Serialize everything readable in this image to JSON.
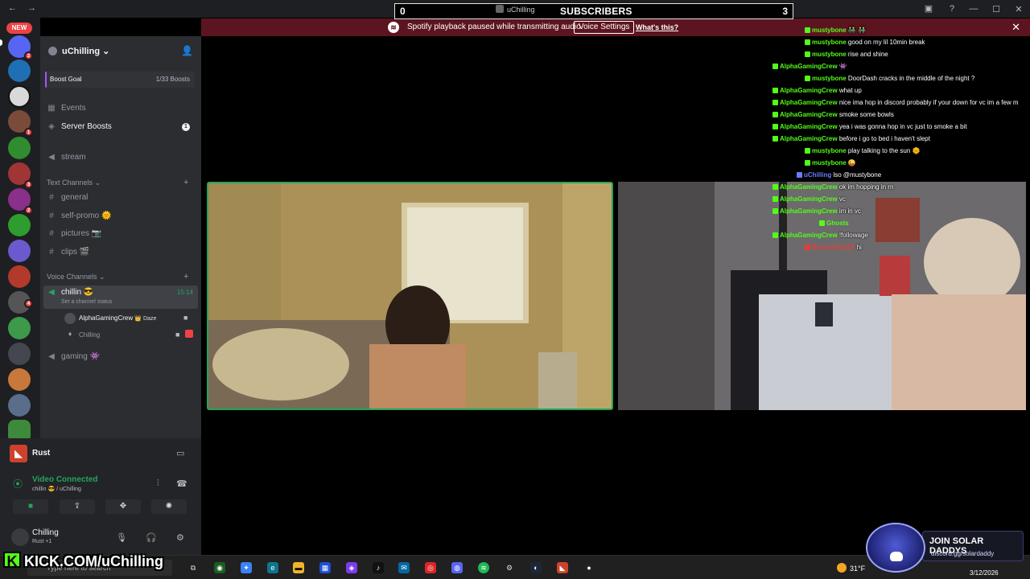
{
  "badge_new": "NEW",
  "subscribers": {
    "left": "0",
    "user": "uChilling",
    "label": "SUBSCRIBERS",
    "right": "3"
  },
  "notice": {
    "message": "Spotify playback paused while transmitting audio.",
    "button": "Voice Settings",
    "link": "What's this?"
  },
  "server": {
    "name": "uChilling",
    "boost_goal_label": "Boost Goal",
    "boost_goal_value": "1/33 Boosts",
    "events": "Events",
    "server_boosts": "Server Boosts",
    "server_boosts_count": "1",
    "stream": "stream",
    "text_category": "Text Channels",
    "text_channels": [
      "general",
      "self-promo 🌞",
      "pictures 📷",
      "clips 🎬"
    ],
    "voice_category": "Voice Channels",
    "voice_channel": {
      "name": "chillin 😎",
      "status": "Set a channel status",
      "time": "15:14"
    },
    "voice_users": [
      {
        "name": "AlphaGamingCrew",
        "tag": "👑 Daze"
      },
      {
        "name": "Chilling",
        "tag": ""
      }
    ],
    "gaming": "gaming 👾"
  },
  "rail_badges": [
    "2",
    "1",
    "3",
    "2",
    "4"
  ],
  "voice_panel": {
    "game": "Rust",
    "status": "Video Connected",
    "location": "chillin 😎 / uChilling"
  },
  "user_panel": {
    "name": "Chilling",
    "status": "Rust +1"
  },
  "chat": [
    {
      "user": "mustybone",
      "msg": "👬 👬",
      "color": "#53fc18",
      "indent": 1
    },
    {
      "user": "mustybone",
      "msg": "good on my lil 10min break",
      "color": "#53fc18",
      "indent": 1
    },
    {
      "user": "mustybone",
      "msg": "rise and shine",
      "color": "#53fc18",
      "indent": 1
    },
    {
      "user": "AlphaGamingCrew",
      "msg": "👾",
      "color": "#53fc18",
      "indent": 0
    },
    {
      "user": "mustybone",
      "msg": "DoorDash cracks in the middle of the night ?",
      "color": "#53fc18",
      "indent": 1
    },
    {
      "user": "AlphaGamingCrew",
      "msg": "what up",
      "color": "#53fc18",
      "indent": 0
    },
    {
      "user": "AlphaGamingCrew",
      "msg": "nice ima hop in discord probably if your down for vc im a few m",
      "color": "#53fc18",
      "indent": 0
    },
    {
      "user": "AlphaGamingCrew",
      "msg": "smoke some bowls",
      "color": "#53fc18",
      "indent": 0
    },
    {
      "user": "AlphaGamingCrew",
      "msg": "yea i was gonna hop in vc just to smoke a bit",
      "color": "#53fc18",
      "indent": 0
    },
    {
      "user": "AlphaGamingCrew",
      "msg": "before i go to bed i haven't slept",
      "color": "#53fc18",
      "indent": 0
    },
    {
      "user": "mustybone",
      "msg": "play talking to the sun 🌞",
      "color": "#53fc18",
      "indent": 1
    },
    {
      "user": "mustybone",
      "msg": "😜",
      "color": "#53fc18",
      "indent": 1
    },
    {
      "user": "uChilling",
      "msg": "lso @mustybone",
      "color": "#6b7cff",
      "indent": 2
    },
    {
      "user": "AlphaGamingCrew",
      "msg": "ok im hopping in rn",
      "color": "#53fc18",
      "indent": 0
    },
    {
      "user": "AlphaGamingCrew",
      "msg": "vc",
      "color": "#53fc18",
      "indent": 0
    },
    {
      "user": "AlphaGamingCrew",
      "msg": "im in vc",
      "color": "#53fc18",
      "indent": 0
    },
    {
      "user": "Ghosts",
      "msg": "",
      "color": "#53fc18",
      "indent": 3
    },
    {
      "user": "AlphaGamingCrew",
      "msg": "!followage",
      "color": "#53fc18",
      "indent": 0
    },
    {
      "user": "Bossshow321",
      "msg": "hi",
      "color": "#e83b3b",
      "indent": 1
    }
  ],
  "taskbar": {
    "search": "Type here to search",
    "weather": "31°F",
    "date": "3/12/2026"
  },
  "kick": {
    "text": "KICK.COM/uChilling"
  },
  "promo": {
    "title": "JOIN SOLAR DADDYS",
    "url": "discord.gg/solardaddy"
  }
}
